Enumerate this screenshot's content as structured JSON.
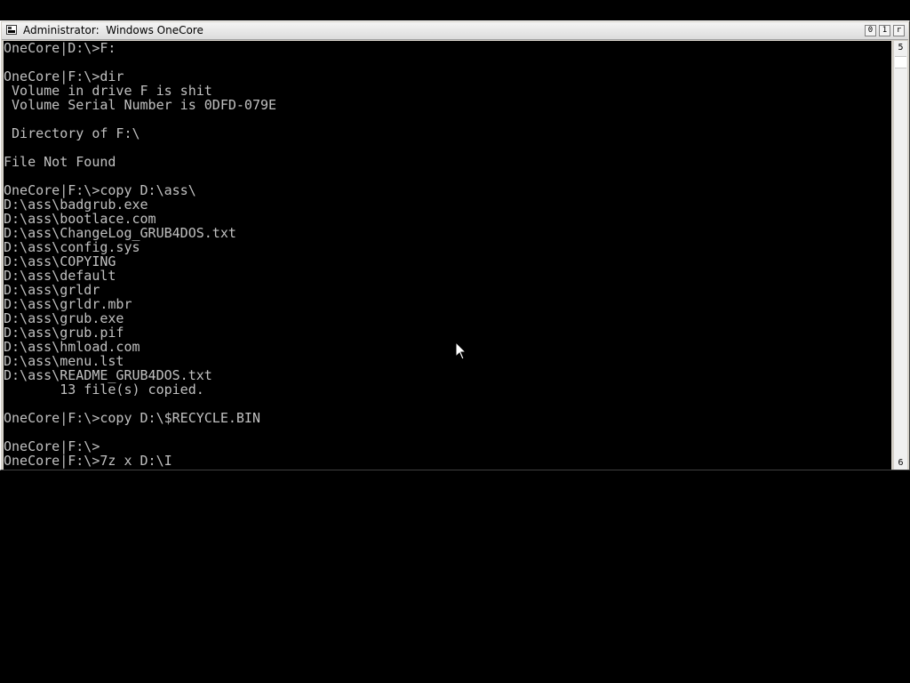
{
  "window": {
    "title": "Administrator:  Windows OneCore",
    "buttons": {
      "minimize": "0",
      "maximize": "1",
      "close": "r"
    }
  },
  "scrollbar": {
    "up_glyph": "5",
    "down_glyph": "6"
  },
  "console": {
    "lines": [
      "OneCore|D:\\>F:",
      "",
      "OneCore|F:\\>dir",
      " Volume in drive F is shit",
      " Volume Serial Number is 0DFD-079E",
      "",
      " Directory of F:\\",
      "",
      "File Not Found",
      "",
      "OneCore|F:\\>copy D:\\ass\\",
      "D:\\ass\\badgrub.exe",
      "D:\\ass\\bootlace.com",
      "D:\\ass\\ChangeLog_GRUB4DOS.txt",
      "D:\\ass\\config.sys",
      "D:\\ass\\COPYING",
      "D:\\ass\\default",
      "D:\\ass\\grldr",
      "D:\\ass\\grldr.mbr",
      "D:\\ass\\grub.exe",
      "D:\\ass\\grub.pif",
      "D:\\ass\\hmload.com",
      "D:\\ass\\menu.lst",
      "D:\\ass\\README_GRUB4DOS.txt",
      "       13 file(s) copied.",
      "",
      "OneCore|F:\\>copy D:\\$RECYCLE.BIN",
      "",
      "OneCore|F:\\>",
      "OneCore|F:\\>7z x D:\\I"
    ]
  },
  "icons": {
    "window": "console-window-icon",
    "cursor": "mouse-pointer-icon"
  },
  "colors": {
    "console_background": "#000000",
    "console_text": "#c0c0c0",
    "title_bar": "#dcdcdc"
  }
}
